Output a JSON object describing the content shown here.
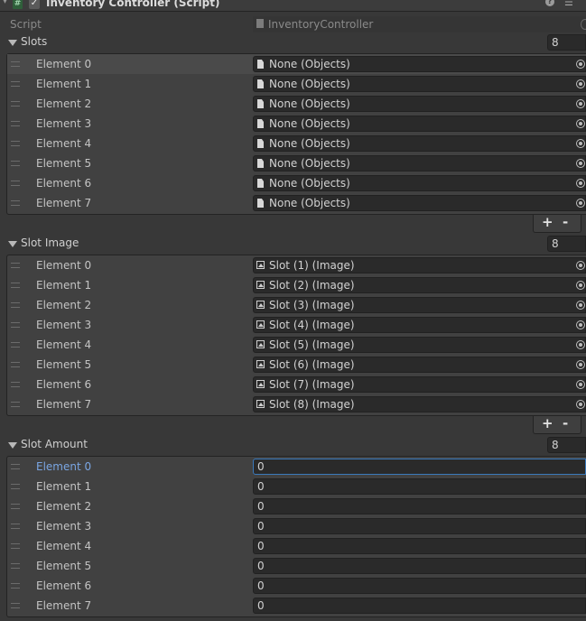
{
  "component": {
    "title": "Inventory Controller (Script)",
    "enabled": true,
    "icons": [
      "script-icon",
      "help-icon",
      "settings-icon"
    ]
  },
  "script_field": {
    "label": "Script",
    "value": "InventoryController"
  },
  "slots": {
    "title": "Slots",
    "count": "8",
    "elements": [
      {
        "label": "Element 0",
        "value": "None (Objects)"
      },
      {
        "label": "Element 1",
        "value": "None (Objects)"
      },
      {
        "label": "Element 2",
        "value": "None (Objects)"
      },
      {
        "label": "Element 3",
        "value": "None (Objects)"
      },
      {
        "label": "Element 4",
        "value": "None (Objects)"
      },
      {
        "label": "Element 5",
        "value": "None (Objects)"
      },
      {
        "label": "Element 6",
        "value": "None (Objects)"
      },
      {
        "label": "Element 7",
        "value": "None (Objects)"
      }
    ],
    "add_label": "+",
    "remove_label": "-"
  },
  "slot_image": {
    "title": "Slot Image",
    "count": "8",
    "elements": [
      {
        "label": "Element 0",
        "value": "Slot (1) (Image)"
      },
      {
        "label": "Element 1",
        "value": "Slot (2) (Image)"
      },
      {
        "label": "Element 2",
        "value": "Slot (3) (Image)"
      },
      {
        "label": "Element 3",
        "value": "Slot (4) (Image)"
      },
      {
        "label": "Element 4",
        "value": "Slot (5) (Image)"
      },
      {
        "label": "Element 5",
        "value": "Slot (6) (Image)"
      },
      {
        "label": "Element 6",
        "value": "Slot (7) (Image)"
      },
      {
        "label": "Element 7",
        "value": "Slot (8) (Image)"
      }
    ],
    "add_label": "+",
    "remove_label": "-"
  },
  "slot_amount": {
    "title": "Slot Amount",
    "count": "8",
    "elements": [
      {
        "label": "Element 0",
        "value": "0"
      },
      {
        "label": "Element 1",
        "value": "0"
      },
      {
        "label": "Element 2",
        "value": "0"
      },
      {
        "label": "Element 3",
        "value": "0"
      },
      {
        "label": "Element 4",
        "value": "0"
      },
      {
        "label": "Element 5",
        "value": "0"
      },
      {
        "label": "Element 6",
        "value": "0"
      },
      {
        "label": "Element 7",
        "value": "0"
      }
    ]
  }
}
